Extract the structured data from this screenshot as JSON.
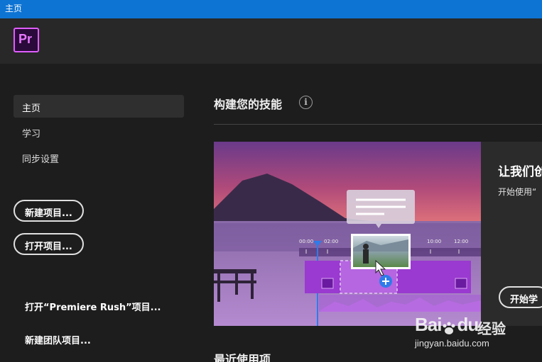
{
  "window": {
    "title": "主页"
  },
  "app": {
    "logo_text": "Pr"
  },
  "sidebar": {
    "items": [
      {
        "label": "主页",
        "active": true
      },
      {
        "label": "学习",
        "active": false
      },
      {
        "label": "同步设置",
        "active": false
      }
    ],
    "new_project_button": "新建项目...",
    "open_project_button": "打开项目...",
    "open_rush_link": "打开“Premiere Rush”项目...",
    "new_team_project_link": "新建团队项目..."
  },
  "main": {
    "section_title": "构建您的技能",
    "info_icon": "i",
    "card": {
      "heading": "让我们创",
      "subtitle": "开始使用“",
      "button": "开始学",
      "timecodes": [
        "00:00",
        "02:00",
        "10:00",
        "12:00"
      ]
    },
    "recent_title": "最近使用项"
  },
  "watermark": {
    "brand": "Bai",
    "brand_suffix": "du",
    "cn": "经验",
    "url": "jingyan.baidu.com"
  },
  "colors": {
    "titlebar": "#0d74d4",
    "accent_purple": "#e05dff",
    "background": "#1d1d1d"
  }
}
